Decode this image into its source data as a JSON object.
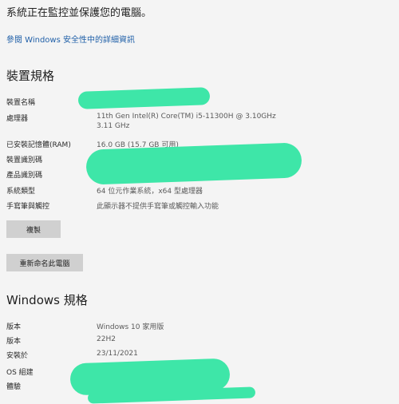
{
  "top": {
    "status": "系統正在監控並保護您的電腦。",
    "security_link": "參閱 Windows 安全性中的詳細資訊"
  },
  "device": {
    "heading": "裝置規格",
    "rows": [
      {
        "label": "裝置名稱",
        "value": ""
      },
      {
        "label": "處理器",
        "value": "11th Gen Intel(R) Core(TM) i5-11300H @ 3.10GHz",
        "value2": "3.11 GHz"
      },
      {
        "label": "已安裝記憶體(RAM)",
        "value": "16.0 GB (15.7 GB 可用)"
      },
      {
        "label": "裝置識別碼",
        "value": ""
      },
      {
        "label": "產品識別碼",
        "value": ""
      },
      {
        "label": "系統類型",
        "value": "64 位元作業系統，x64 型處理器"
      },
      {
        "label": "手寫筆與觸控",
        "value": "此顯示器不提供手寫筆或觸控輸入功能"
      }
    ],
    "copy_button": "複製",
    "rename_button": "重新命名此電腦"
  },
  "windows": {
    "heading": "Windows 規格",
    "rows": [
      {
        "label": "版本",
        "value": "Windows 10 家用版"
      },
      {
        "label": "版本",
        "value": "22H2"
      },
      {
        "label": "安裝於",
        "value": "23/11/2021"
      },
      {
        "label": "OS 組建",
        "value": ""
      },
      {
        "label": "體驗",
        "value": ""
      }
    ]
  },
  "colors": {
    "redaction": "#3ee6a8",
    "link": "#1f5fa8",
    "button": "#d0d0d0"
  }
}
